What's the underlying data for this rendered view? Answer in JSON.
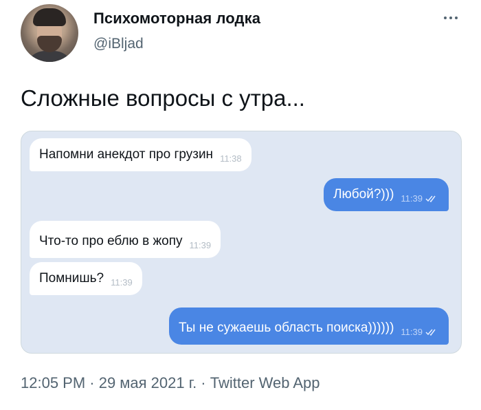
{
  "author": {
    "display_name": "Психомоторная лодка",
    "handle": "@iBljad"
  },
  "tweet": {
    "text": "Сложные вопросы с утра..."
  },
  "chat": {
    "messages": [
      {
        "direction": "incoming",
        "text": "Напомни анекдот про грузин",
        "time": "11:38"
      },
      {
        "direction": "outgoing",
        "text": "Любой?)))",
        "time": "11:39",
        "read": true
      },
      {
        "direction": "incoming",
        "text": "Что-то про еблю в жопу",
        "time": "11:39"
      },
      {
        "direction": "incoming",
        "text": "Помнишь?",
        "time": "11:39"
      },
      {
        "direction": "outgoing",
        "text": "Ты не сужаешь область поиска))))))",
        "time": "11:39",
        "read": true
      }
    ]
  },
  "footer": {
    "meta": "12:05 PM · 29 мая 2021 г. · Twitter Web App"
  },
  "icons": {
    "more": "more-horizontal-icon",
    "read_receipt": "double-check-icon"
  }
}
